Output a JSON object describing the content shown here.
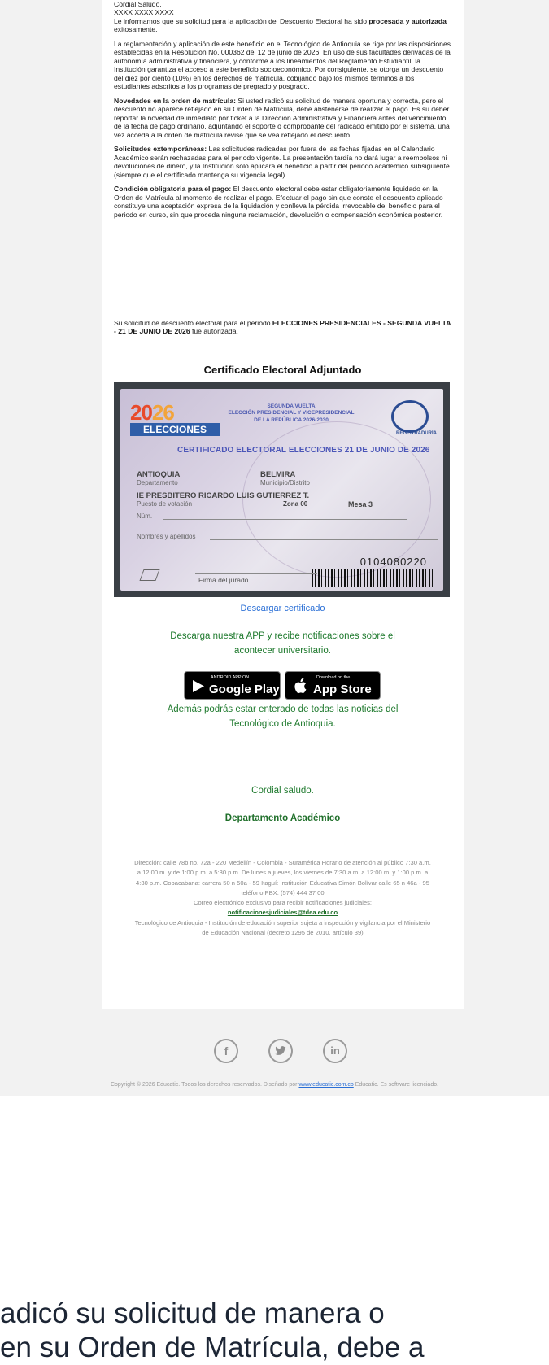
{
  "letter": {
    "greeting": "Cordial Saludo,",
    "recipient": "XXXX XXXX XXXX",
    "intro_prefix": "Le informamos que su solicitud para la aplicación del Descuento Electoral ha sido",
    "intro_bold": "procesada y autorizada",
    "intro_suffix": "exitosamente.",
    "p1": "La reglamentación y aplicación de este beneficio en el Tecnológico de Antioquia se rige por las disposiciones establecidas en la Resolución No. 000362 del 12 de junio de 2026. En uso de sus facultades derivadas de la autonomía administrativa y financiera, y conforme a los lineamientos del Reglamento Estudiantil, la Institución garantiza el acceso a este beneficio socioeconómico. Por consiguiente, se otorga un descuento del diez por ciento (10%) en los derechos de matrícula, cobijando bajo los mismos términos a los estudiantes adscritos a los programas de pregrado y posgrado.",
    "p2_bold": "Novedades en la orden de matrícula:",
    "p2": "Si usted radicó su solicitud de manera oportuna y correcta, pero el descuento no aparece reflejado en su Orden de Matrícula, debe abstenerse de realizar el pago. Es su deber reportar la novedad de inmediato por ticket a la Dirección Administrativa y Financiera antes del vencimiento de la fecha de pago ordinario, adjuntando el soporte o comprobante del radicado emitido por el sistema, una vez acceda a la orden de matrícula revise que se vea reflejado el descuento.",
    "p3_bold": "Solicitudes extemporáneas:",
    "p3": "Las solicitudes radicadas por fuera de las fechas fijadas en el Calendario Académico serán rechazadas para el periodo vigente. La presentación tardía no dará lugar a reembolsos ni devoluciones de dinero, y la Institución solo aplicará el beneficio a partir del periodo académico subsiguiente (siempre que el certificado mantenga su vigencia legal).",
    "p4_bold": "Condición obligatoria para el pago:",
    "p4": "El descuento electoral debe estar obligatoriamente liquidado en la Orden de Matrícula al momento de realizar el pago. Efectuar el pago sin que conste el descuento aplicado constituye una aceptación expresa de la liquidación y conlleva la pérdida irrevocable del beneficio para el periodo en curso, sin que proceda ninguna reclamación, devolución o compensación económica posterior.",
    "auth_prefix": "Su solicitud de descuento electoral para el periodo",
    "auth_bold": "ELECCIONES PRESIDENCIALES - SEGUNDA VUELTA - 21 DE JUNIO DE 2026",
    "auth_suffix": "fue autorizada."
  },
  "certificate": {
    "section_title": "Certificado Electoral Adjuntado",
    "year_a": "20",
    "year_b": "26",
    "elections": "ELECCIONES",
    "header_lines": [
      "SEGUNDA VUELTA",
      "ELECCIÓN PRESIDENCIAL Y VICEPRESIDENCIAL",
      "DE LA REPÚBLICA 2026-2030"
    ],
    "registry": "REGISTRADURÍA",
    "title": "CERTIFICADO ELECTORAL ELECCIONES 21 DE JUNIO DE 2026",
    "department": "ANTIOQUIA",
    "department_label": "Departamento",
    "municipality": "BELMIRA",
    "municipality_label": "Municipio/Distrito",
    "polling_place": "IE PRESBITERO RICARDO LUIS GUTIERREZ T.",
    "polling_label": "Puesto de votación",
    "zone": "Zona  00",
    "table": "Mesa 3",
    "number_label": "Núm.",
    "names_label": "Nombres y apellidos",
    "serial": "0104080220",
    "signature_label": "Firma del jurado"
  },
  "download_link": "Descargar certificado",
  "app_promo": [
    "Descarga nuestra APP y recibe notificaciones sobre el",
    "acontecer universitario."
  ],
  "google_play": {
    "small": "ANDROID APP ON",
    "big": "Google Play"
  },
  "app_store": {
    "small": "Download on the",
    "big": "App Store"
  },
  "news_promo": [
    "Además podrás estar enterado de todas las noticias del",
    "Tecnológico de Antioquia."
  ],
  "closing": "Cordial saludo.",
  "signature": "Departamento Académico",
  "footer": {
    "address": "Dirección: calle 78b no. 72a - 220 Medellín - Colombia - Suramérica Horario de atención al público 7:30 a.m. a 12:00 m. y de 1:00 p.m. a 5:30 p.m. De lunes a jueves, los viernes de 7:30 a.m. a 12:00 m. y 1:00 p.m. a 4:30 p.m. Copacabana: carrera 50 n 50a - 59 Itaguí: Institución Educativa Simón Bolívar calle 65 n 46a - 95 teléfono PBX: (574) 444 37 00",
    "email_label": "Correo electrónico exclusivo para recibir notificaciones judiciales:",
    "email": "notificacionesjudiciales@tdea.edu.co",
    "legal": "Tecnológico de Antioquia - Institución de educación superior sujeta a inspección y vigilancia por el Ministerio de Educación Nacional (decreto 1295 de 2010, artículo 39)"
  },
  "social": {
    "facebook": "f",
    "twitter": "t",
    "linkedin": "in"
  },
  "copyright": {
    "prefix": "Copyright © 2026 Educatic. Todos los derechos reservados. Diseñado por",
    "link": "www.educatic.com.co",
    "suffix": "Educatic. Es software licenciado."
  },
  "zoom_text": [
    "adicó su solicitud de manera o",
    "en su Orden de Matrícula, debe a"
  ]
}
